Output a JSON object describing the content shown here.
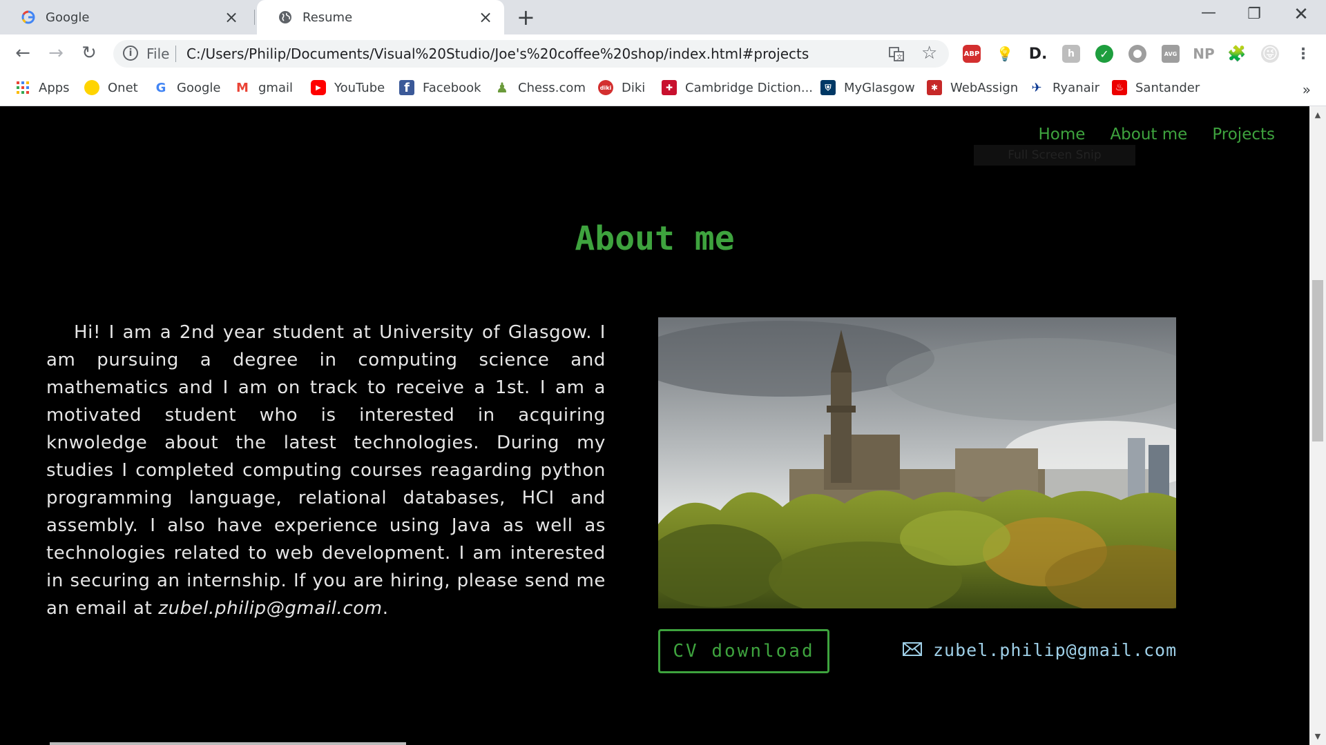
{
  "browser": {
    "tabs": [
      {
        "title": "Google",
        "icon": "google-g-icon"
      },
      {
        "title": "Resume",
        "icon": "globe-icon"
      }
    ],
    "address": {
      "scheme_label": "File",
      "url": "C:/Users/Philip/Documents/Visual%20Studio/Joe's%20coffee%20shop/index.html#projects"
    },
    "bookmarks": [
      {
        "label": "Apps",
        "icon": "apps-grid-icon"
      },
      {
        "label": "Onet",
        "icon": "onet-icon"
      },
      {
        "label": "Google",
        "icon": "google-g-icon"
      },
      {
        "label": "gmail",
        "icon": "gmail-icon"
      },
      {
        "label": "YouTube",
        "icon": "youtube-icon"
      },
      {
        "label": "Facebook",
        "icon": "facebook-icon"
      },
      {
        "label": "Chess.com",
        "icon": "chess-pawn-icon"
      },
      {
        "label": "Diki",
        "icon": "diki-icon"
      },
      {
        "label": "Cambridge Diction...",
        "icon": "cambridge-shield-icon"
      },
      {
        "label": "MyGlasgow",
        "icon": "glasgow-crest-icon"
      },
      {
        "label": "WebAssign",
        "icon": "webassign-icon"
      },
      {
        "label": "Ryanair",
        "icon": "ryanair-icon"
      },
      {
        "label": "Santander",
        "icon": "santander-icon"
      }
    ],
    "extensions": {
      "abp": "ABP",
      "d": "D.",
      "np": "NP"
    }
  },
  "page": {
    "nav": [
      "Home",
      "About me",
      "Projects"
    ],
    "tooltip": "Full Screen Snip",
    "heading": "About me",
    "about_text": "Hi! I am a 2nd year student at University of Glasgow. I am pursuing a degree in computing science and mathematics and I am on track to receive a 1st. I am a motivated student who is interested in acquiring knwoledge about the latest technologies. During my studies I completed computing courses reagarding python programming language, relational databases, HCI and assembly. I also have experience using Java as well as technologies related to web development. I am interested in securing an internship. If you are hiring, please send me an email at ",
    "about_email": "zubel.philip@gmail.com",
    "about_end": ".",
    "photo": "university-of-glasgow-photo",
    "cv_button": "CV download",
    "email": "zubel.philip@gmail.com"
  },
  "colors": {
    "accent_green": "#3ea33e",
    "email_blue": "#9fd0e8",
    "background": "#000000"
  }
}
